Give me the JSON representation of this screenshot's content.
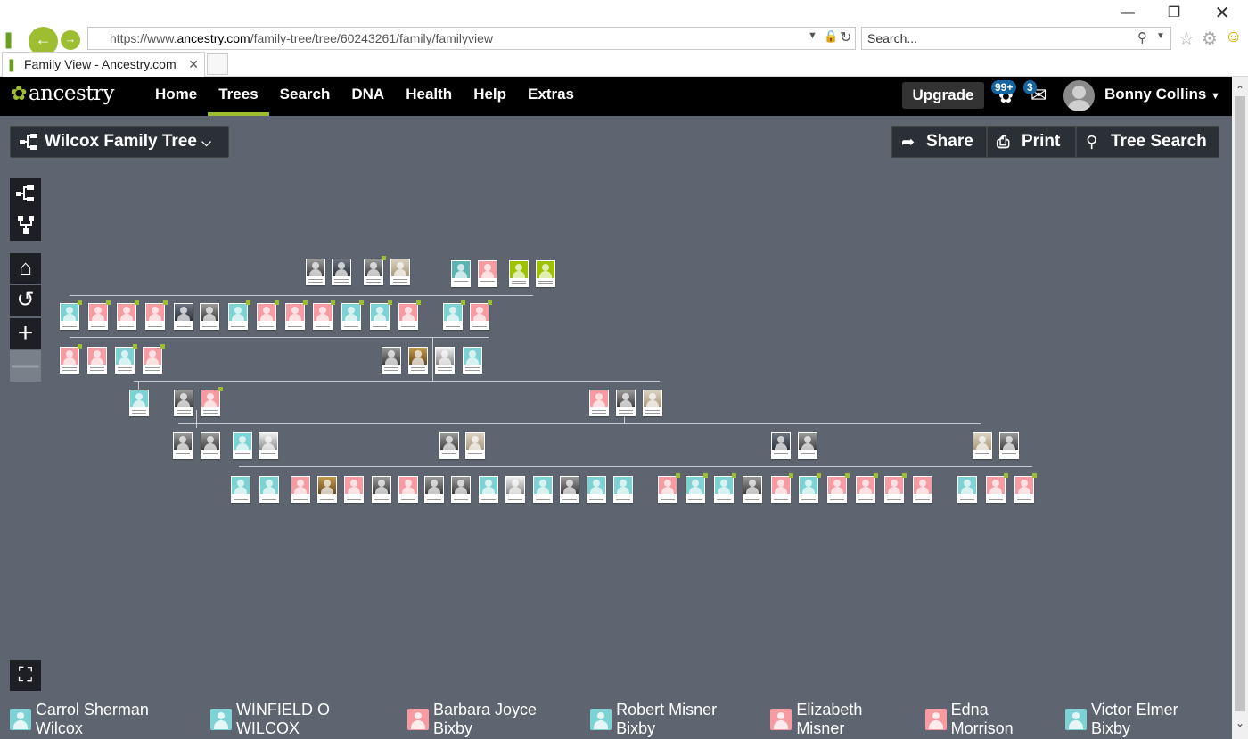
{
  "browser": {
    "url_prefix": "https://www.",
    "url_domain": "ancestry.com",
    "url_path": "/family-tree/tree/60243261/family/familyview",
    "search_placeholder": "Search...",
    "tab_title": "Family View - Ancestry.com"
  },
  "header": {
    "logo": "ancestry",
    "nav": [
      "Home",
      "Trees",
      "Search",
      "DNA",
      "Health",
      "Help",
      "Extras"
    ],
    "active_nav": "Trees",
    "upgrade": "Upgrade",
    "hints_badge": "99+",
    "messages_badge": "3",
    "user": "Bonny Collins"
  },
  "tree": {
    "name": "Wilcox Family Tree",
    "share": "Share",
    "print": "Print",
    "tree_search": "Tree Search"
  },
  "recent_people": [
    {
      "name": "Carrol Sherman Wilcox",
      "gender": "m"
    },
    {
      "name": "WINFIELD O WILCOX",
      "gender": "m"
    },
    {
      "name": "Barbara Joyce Bixby",
      "gender": "f"
    },
    {
      "name": "Robert Misner Bixby",
      "gender": "m"
    },
    {
      "name": "Elizabeth Misner",
      "gender": "f"
    },
    {
      "name": "Edna Morrison",
      "gender": "f"
    },
    {
      "name": "Victor Elmer Bixby",
      "gender": "m"
    }
  ]
}
